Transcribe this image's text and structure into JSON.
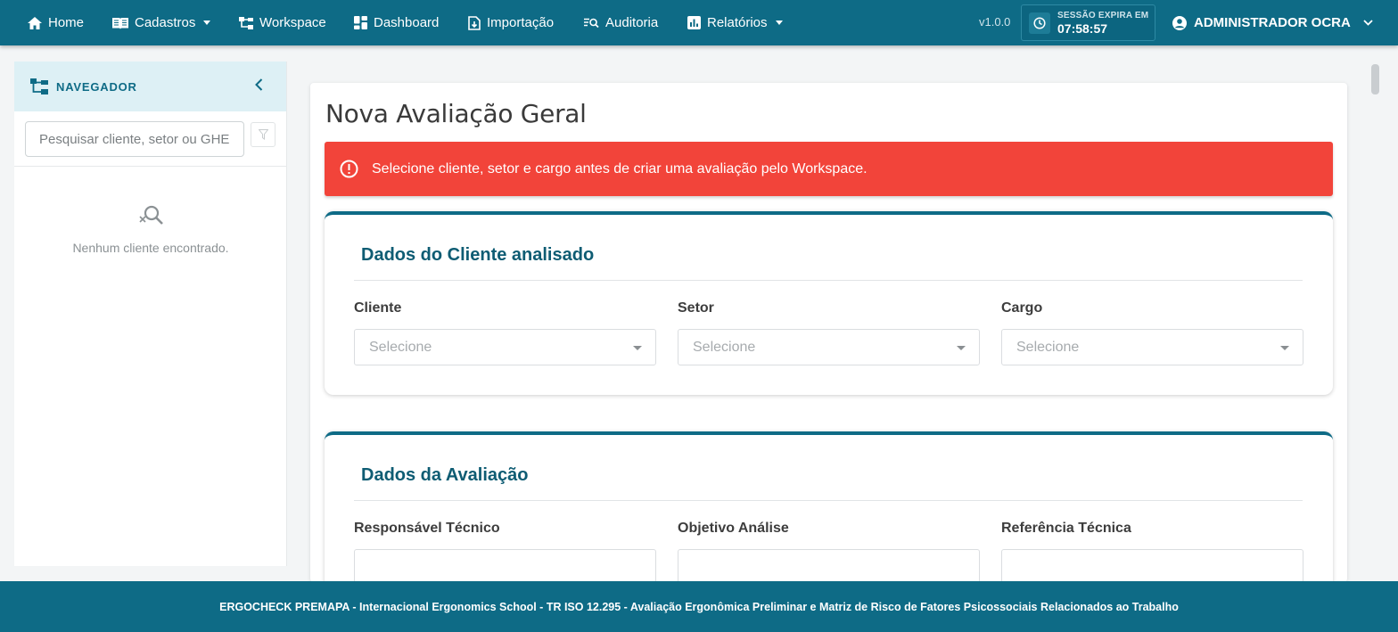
{
  "nav": {
    "items": [
      {
        "label": "Home",
        "icon": "home-icon",
        "dropdown": false
      },
      {
        "label": "Cadastros",
        "icon": "book-icon",
        "dropdown": true
      },
      {
        "label": "Workspace",
        "icon": "hierarchy-icon",
        "dropdown": false
      },
      {
        "label": "Dashboard",
        "icon": "dashboard-icon",
        "dropdown": false
      },
      {
        "label": "Importação",
        "icon": "file-import-icon",
        "dropdown": false
      },
      {
        "label": "Auditoria",
        "icon": "audit-search-icon",
        "dropdown": false
      },
      {
        "label": "Relatórios",
        "icon": "chart-icon",
        "dropdown": true
      }
    ],
    "version": "v1.0.0",
    "session_label": "SESSÃO EXPIRA EM",
    "session_time": "07:58:57",
    "user_name": "ADMINISTRADOR OCRA"
  },
  "sidebar": {
    "title": "NAVEGADOR",
    "search_placeholder": "Pesquisar cliente, setor ou GHE",
    "empty_message": "Nenhum cliente encontrado."
  },
  "main": {
    "title": "Nova Avaliação Geral",
    "alert": "Selecione cliente, setor e cargo antes de criar uma avaliação pelo Workspace.",
    "client_section": {
      "title": "Dados do Cliente analisado",
      "fields": [
        {
          "label": "Cliente",
          "placeholder": "Selecione"
        },
        {
          "label": "Setor",
          "placeholder": "Selecione"
        },
        {
          "label": "Cargo",
          "placeholder": "Selecione"
        }
      ]
    },
    "evaluation_section": {
      "title": "Dados da Avaliação",
      "fields": [
        {
          "label": "Responsável Técnico"
        },
        {
          "label": "Objetivo Análise"
        },
        {
          "label": "Referência Técnica"
        }
      ]
    }
  },
  "footer": {
    "text": "ERGOCHECK PREMAPA - Internacional Ergonomics School - TR ISO 12.295 - Avaliação Ergonômica Preliminar e Matriz de Risco de Fatores Psicossociais Relacionados ao Trabalho"
  },
  "colors": {
    "primary": "#0e6b86",
    "alert": "#f2443a",
    "sidebar_header": "#ddf0f5",
    "section_title": "#0e5c73"
  }
}
